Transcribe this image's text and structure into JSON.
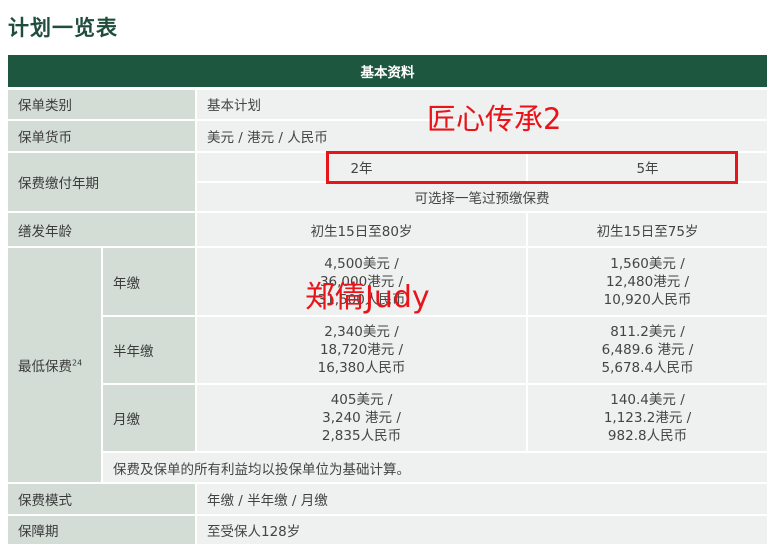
{
  "title": "计划一览表",
  "table": {
    "header": "基本资料",
    "plan_type": {
      "label": "保单类别",
      "value": "基本计划"
    },
    "currency": {
      "label": "保单货币",
      "value": "美元 / 港元 / 人民币"
    },
    "payment_period": {
      "label": "保费缴付年期",
      "options": [
        "2年",
        "5年"
      ],
      "note": "可选择一笔过预缴保费"
    },
    "issue_age": {
      "label": "缮发年龄",
      "values": [
        "初生15日至80岁",
        "初生15日至75岁"
      ]
    },
    "min_premium": {
      "label": "最低保费",
      "footnote": "24",
      "rows": [
        {
          "mode": "年缴",
          "two_year": [
            "4,500美元 /",
            "36,000港元 /",
            "31,500人民币"
          ],
          "five_year": [
            "1,560美元 /",
            "12,480港元 /",
            "10,920人民币"
          ]
        },
        {
          "mode": "半年缴",
          "two_year": [
            "2,340美元 /",
            "18,720港元 /",
            "16,380人民币"
          ],
          "five_year": [
            "811.2美元 /",
            "6,489.6 港元 /",
            "5,678.4人民币"
          ]
        },
        {
          "mode": "月缴",
          "two_year": [
            "405美元 /",
            "3,240 港元 /",
            "2,835人民币"
          ],
          "five_year": [
            "140.4美元 /",
            "1,123.2港元 /",
            "982.8人民币"
          ]
        }
      ],
      "note": "保费及保单的所有利益均以投保单位为基础计算。"
    },
    "premium_mode": {
      "label": "保费模式",
      "value": "年缴 / 半年缴 / 月缴"
    },
    "coverage": {
      "label": "保障期",
      "value": "至受保人128岁"
    }
  },
  "watermarks": [
    "匠心传承2",
    "郑倩Judy"
  ],
  "colors": {
    "header": "#1e5740",
    "label_bg": "#d3ddd6",
    "value_bg": "#eef1ef",
    "highlight": "#e8141a"
  }
}
